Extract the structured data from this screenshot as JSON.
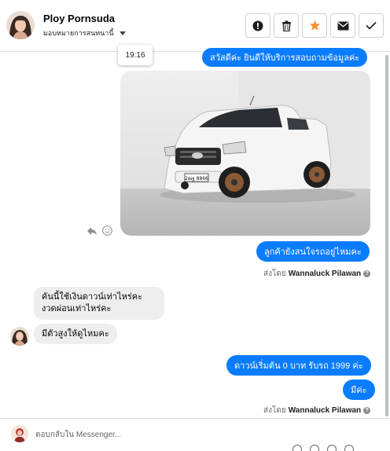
{
  "header": {
    "contact_name": "Ploy Pornsuda",
    "subtitle": "มอบหมายการสนทนานี้"
  },
  "colors": {
    "accent": "#0a7cff",
    "star": "#f7923a",
    "incoming_bubble": "#eeeeee"
  },
  "actions": [
    {
      "name": "alert-icon"
    },
    {
      "name": "trash-icon"
    },
    {
      "name": "star-icon"
    },
    {
      "name": "mail-icon"
    },
    {
      "name": "check-icon"
    }
  ],
  "tooltip_time": "19:16",
  "messages": {
    "greeting": "สวัสดีค่ะ  ยินดีให้บริการสอบถามข้อมูลค่ะ",
    "ask_interest": "ลูกค้ายังสนใจรถอยู่ไหมคะ",
    "incoming_1": "คันนี้ใช้เงินดาวน์เท่าไหร่คะงวดผ่อนเท่าไหร่คะ",
    "incoming_2": "มีตัวสูงให้ดูไหมคะ",
    "reply_down": "ดาวน์เริ่มต้น 0 บาท รับรถ 1999 ค่ะ",
    "reply_yes": "มีค่ะ"
  },
  "sent_by": {
    "prefix": "ส่งโดย",
    "agent": "Wannaluck Pilawan"
  },
  "photo": {
    "plate": "2ฒฐ 8866"
  },
  "composer": {
    "placeholder": "ตอบกลับใน Messenger..."
  }
}
